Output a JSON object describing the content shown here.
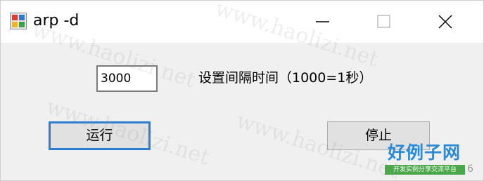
{
  "window": {
    "title": "arp -d"
  },
  "form": {
    "interval_value": "3000",
    "interval_label": "设置间隔时间（1000=1秒）",
    "run_label": "运行",
    "stop_label": "停止"
  },
  "watermark": {
    "text": "www.haolizi.net",
    "logo_text": "好例子网",
    "logo_subtext": "开发实例分享交流平台",
    "logo_digit": "6"
  },
  "colors": {
    "window_bg": "#f0f0f0",
    "titlebar_bg": "#ffffff",
    "default_button_border": "#2a7fd4",
    "button_bg": "#e1e1e1",
    "logo_blue": "#2b8ad6",
    "logo_green": "#4aa84a"
  },
  "icons": {
    "app": "app-icon",
    "minimize": "minimize-icon",
    "maximize": "maximize-icon",
    "close": "close-icon"
  }
}
